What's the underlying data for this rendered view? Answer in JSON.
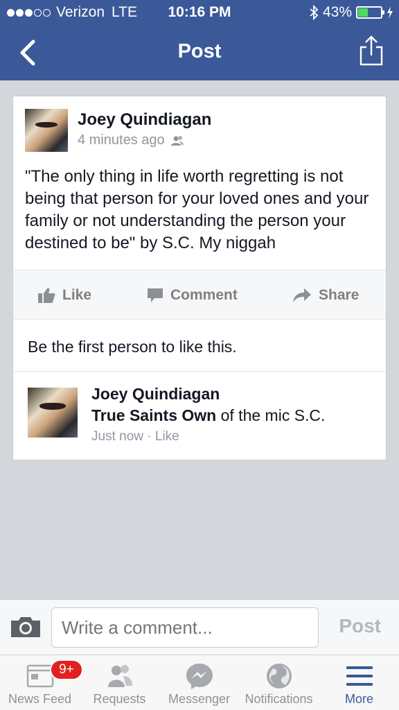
{
  "status_bar": {
    "carrier": "Verizon",
    "network": "LTE",
    "time": "10:16 PM",
    "battery": "43%",
    "battery_level": 0.43
  },
  "nav": {
    "title": "Post",
    "back_icon": "chevron-left-icon",
    "share_icon": "share-icon"
  },
  "post": {
    "author": "Joey Quindiagan",
    "time": "4 minutes ago",
    "audience_icon": "friends-icon",
    "text": "\"The only thing in life worth regretting is not being that person for your loved ones and your family or not understanding the person your destined to be\" by S.C. My niggah"
  },
  "actions": {
    "like": "Like",
    "comment": "Comment",
    "share": "Share"
  },
  "likes_line": "Be the first person to like this.",
  "comment": {
    "author": "Joey Quindiagan",
    "tag": "True Saints Own",
    "text": " of the mic S.C.",
    "time": "Just now",
    "separator": " · ",
    "like": "Like"
  },
  "composer": {
    "placeholder": "Write a comment...",
    "post_label": "Post"
  },
  "tabs": [
    {
      "label": "News Feed",
      "icon": "news-feed-icon",
      "badge": "9+"
    },
    {
      "label": "Requests",
      "icon": "friend-requests-icon"
    },
    {
      "label": "Messenger",
      "icon": "messenger-icon"
    },
    {
      "label": "Notifications",
      "icon": "globe-icon"
    },
    {
      "label": "More",
      "icon": "menu-icon",
      "active": true
    }
  ],
  "colors": {
    "brand": "#3b5998",
    "badge": "#e1211f",
    "battery": "#4cd964"
  }
}
